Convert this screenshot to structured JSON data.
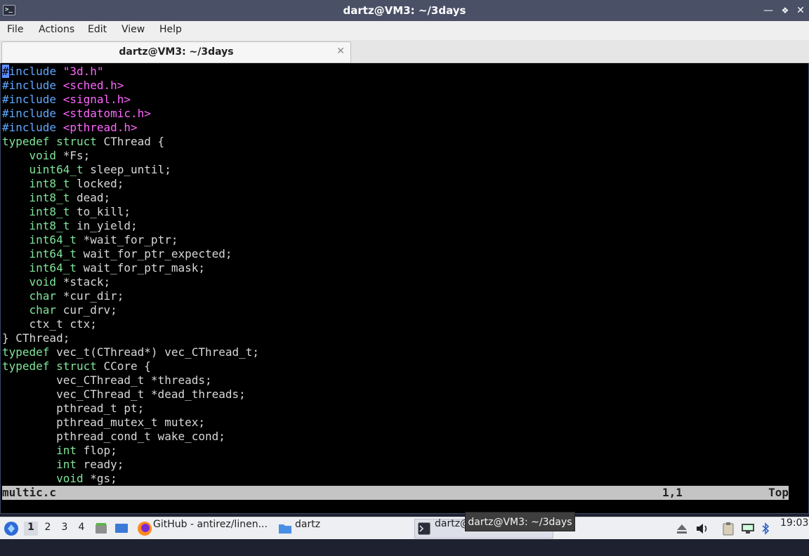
{
  "window": {
    "title": "dartz@VM3: ~/3days",
    "app_icon": "terminal-icon",
    "controls": [
      "minimize-icon",
      "maximize-icon",
      "close-icon"
    ]
  },
  "menubar": {
    "items": [
      "File",
      "Actions",
      "Edit",
      "View",
      "Help"
    ]
  },
  "tabs": [
    {
      "label": "dartz@VM3: ~/3days",
      "close_icon": "close-icon"
    }
  ],
  "editor": {
    "lines": [
      [
        {
          "t": "#",
          "c": "cursor"
        },
        {
          "t": "include ",
          "c": "pre"
        },
        {
          "t": "\"3d.h\"",
          "c": "str"
        }
      ],
      [
        {
          "t": "#include ",
          "c": "pre"
        },
        {
          "t": "<sched.h>",
          "c": "str"
        }
      ],
      [
        {
          "t": "#include ",
          "c": "pre"
        },
        {
          "t": "<signal.h>",
          "c": "str"
        }
      ],
      [
        {
          "t": "#include ",
          "c": "pre"
        },
        {
          "t": "<stdatomic.h>",
          "c": "str"
        }
      ],
      [
        {
          "t": "#include ",
          "c": "pre"
        },
        {
          "t": "<pthread.h>",
          "c": "str"
        }
      ],
      [
        {
          "t": "typedef struct",
          "c": "type"
        },
        {
          "t": " CThread {",
          "c": "plain"
        }
      ],
      [
        {
          "t": "    ",
          "c": "plain"
        },
        {
          "t": "void",
          "c": "type"
        },
        {
          "t": " *Fs;",
          "c": "plain"
        }
      ],
      [
        {
          "t": "    ",
          "c": "plain"
        },
        {
          "t": "uint64_t",
          "c": "type"
        },
        {
          "t": " sleep_until;",
          "c": "plain"
        }
      ],
      [
        {
          "t": "    ",
          "c": "plain"
        },
        {
          "t": "int8_t",
          "c": "type"
        },
        {
          "t": " locked;",
          "c": "plain"
        }
      ],
      [
        {
          "t": "    ",
          "c": "plain"
        },
        {
          "t": "int8_t",
          "c": "type"
        },
        {
          "t": " dead;",
          "c": "plain"
        }
      ],
      [
        {
          "t": "    ",
          "c": "plain"
        },
        {
          "t": "int8_t",
          "c": "type"
        },
        {
          "t": " to_kill;",
          "c": "plain"
        }
      ],
      [
        {
          "t": "    ",
          "c": "plain"
        },
        {
          "t": "int8_t",
          "c": "type"
        },
        {
          "t": " in_yield;",
          "c": "plain"
        }
      ],
      [
        {
          "t": "    ",
          "c": "plain"
        },
        {
          "t": "int64_t",
          "c": "type"
        },
        {
          "t": " *wait_for_ptr;",
          "c": "plain"
        }
      ],
      [
        {
          "t": "    ",
          "c": "plain"
        },
        {
          "t": "int64_t",
          "c": "type"
        },
        {
          "t": " wait_for_ptr_expected;",
          "c": "plain"
        }
      ],
      [
        {
          "t": "    ",
          "c": "plain"
        },
        {
          "t": "int64_t",
          "c": "type"
        },
        {
          "t": " wait_for_ptr_mask;",
          "c": "plain"
        }
      ],
      [
        {
          "t": "    ",
          "c": "plain"
        },
        {
          "t": "void",
          "c": "type"
        },
        {
          "t": " *stack;",
          "c": "plain"
        }
      ],
      [
        {
          "t": "    ",
          "c": "plain"
        },
        {
          "t": "char",
          "c": "type"
        },
        {
          "t": " *cur_dir;",
          "c": "plain"
        }
      ],
      [
        {
          "t": "    ",
          "c": "plain"
        },
        {
          "t": "char",
          "c": "type"
        },
        {
          "t": " cur_drv;",
          "c": "plain"
        }
      ],
      [
        {
          "t": "    ctx_t ctx;",
          "c": "plain"
        }
      ],
      [
        {
          "t": "} CThread;",
          "c": "plain"
        }
      ],
      [
        {
          "t": "typedef",
          "c": "type"
        },
        {
          "t": " vec_t(CThread*) vec_CThread_t;",
          "c": "plain"
        }
      ],
      [
        {
          "t": "typedef struct",
          "c": "type"
        },
        {
          "t": " CCore {",
          "c": "plain"
        }
      ],
      [
        {
          "t": "        vec_CThread_t *threads;",
          "c": "plain"
        }
      ],
      [
        {
          "t": "        vec_CThread_t *dead_threads;",
          "c": "plain"
        }
      ],
      [
        {
          "t": "        pthread_t pt;",
          "c": "plain"
        }
      ],
      [
        {
          "t": "        pthread_mutex_t mutex;",
          "c": "plain"
        }
      ],
      [
        {
          "t": "        pthread_cond_t wake_cond;",
          "c": "plain"
        }
      ],
      [
        {
          "t": "        ",
          "c": "plain"
        },
        {
          "t": "int",
          "c": "type"
        },
        {
          "t": " flop;",
          "c": "plain"
        }
      ],
      [
        {
          "t": "        ",
          "c": "plain"
        },
        {
          "t": "int",
          "c": "type"
        },
        {
          "t": " ready;",
          "c": "plain"
        }
      ],
      [
        {
          "t": "        ",
          "c": "plain"
        },
        {
          "t": "void",
          "c": "type"
        },
        {
          "t": " *gs;",
          "c": "plain"
        }
      ]
    ],
    "status": {
      "filename": "multic.c",
      "position": "1,1",
      "scroll": "Top"
    },
    "colors": {
      "preprocessor": "#5fa8ff",
      "string": "#ff66ff",
      "type": "#7fe59a",
      "text": "#d8d8d8",
      "cursor": "#5f8fff"
    }
  },
  "taskbar": {
    "start_icon": "start-menu-icon",
    "desktops": [
      "1",
      "2",
      "3",
      "4"
    ],
    "active_desktop": "1",
    "launchers": [
      "file-manager-icon",
      "show-desktop-icon"
    ],
    "tasks": [
      {
        "label": "GitHub - antirez/linen...",
        "icon": "firefox-icon"
      },
      {
        "label": "dartz",
        "icon": "folder-icon"
      },
      {
        "label": "dartz@",
        "icon": "terminal-icon",
        "active": true
      }
    ],
    "tray": [
      "eject-icon",
      "volume-icon",
      "clipboard-icon",
      "network-icon",
      "bluetooth-icon"
    ],
    "clock": "19:03"
  },
  "tooltip": {
    "text": "dartz@VM3: ~/3days"
  }
}
